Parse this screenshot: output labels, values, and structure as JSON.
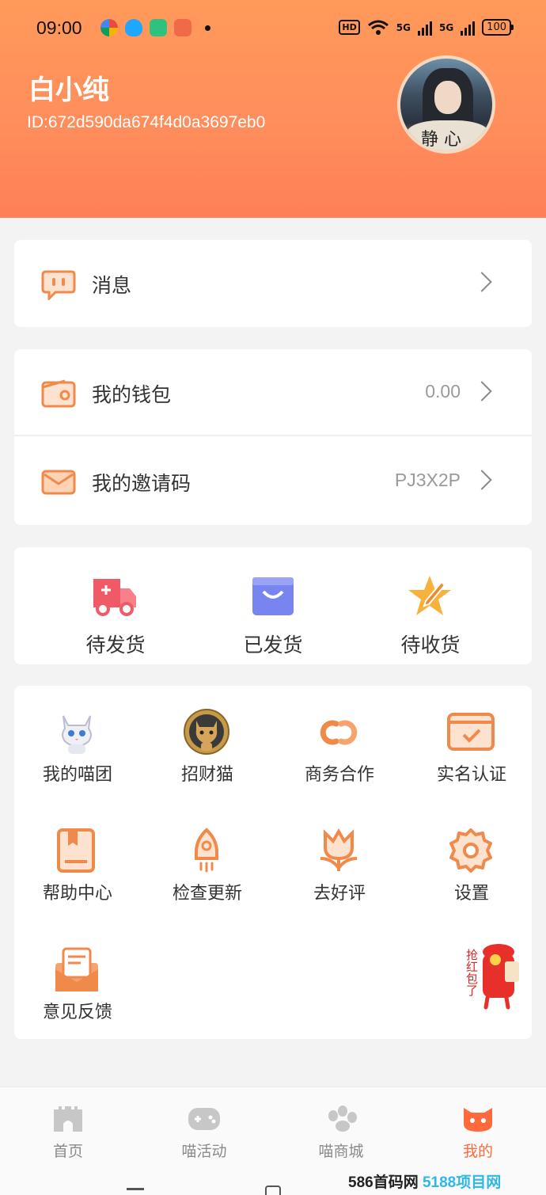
{
  "status_bar": {
    "time": "09:00",
    "hd": "HD",
    "net1": "5G",
    "net2": "5G",
    "battery": "100"
  },
  "profile": {
    "name": "白小纯",
    "id_text": "ID:672d590da674f4d0a3697eb0",
    "avatar_fan_text": "静 心"
  },
  "menu_message": {
    "label": "消息"
  },
  "menu_wallet": {
    "wallet_label": "我的钱包",
    "wallet_value": "0.00",
    "invite_label": "我的邀请码",
    "invite_value": "PJ3X2P"
  },
  "orders": [
    {
      "label": "待发货",
      "icon": "delivery-truck-icon"
    },
    {
      "label": "已发货",
      "icon": "shopping-bag-icon"
    },
    {
      "label": "待收货",
      "icon": "star-pen-icon"
    }
  ],
  "services": [
    {
      "label": "我的喵团",
      "icon": "cat-icon"
    },
    {
      "label": "招财猫",
      "icon": "lucky-cat-icon"
    },
    {
      "label": "商务合作",
      "icon": "link-icon"
    },
    {
      "label": "实名认证",
      "icon": "id-check-icon"
    },
    {
      "label": "帮助中心",
      "icon": "help-book-icon"
    },
    {
      "label": "检查更新",
      "icon": "rocket-icon"
    },
    {
      "label": "去好评",
      "icon": "flower-icon"
    },
    {
      "label": "设置",
      "icon": "gear-icon"
    },
    {
      "label": "意见反馈",
      "icon": "feedback-envelope-icon"
    }
  ],
  "floating": {
    "redpack_text": "抢红包了"
  },
  "tabbar": [
    {
      "label": "首页",
      "icon": "castle-icon"
    },
    {
      "label": "喵活动",
      "icon": "gamepad-icon"
    },
    {
      "label": "喵商城",
      "icon": "paw-icon"
    },
    {
      "label": "我的",
      "icon": "cat-face-icon",
      "active": true
    }
  ],
  "watermark": {
    "prefix": "586首码网",
    "suffix": "5188项目网"
  },
  "colors": {
    "accent": "#ff7f57",
    "header_top": "#ff9a5a",
    "tab_active": "#ff6a3d"
  }
}
